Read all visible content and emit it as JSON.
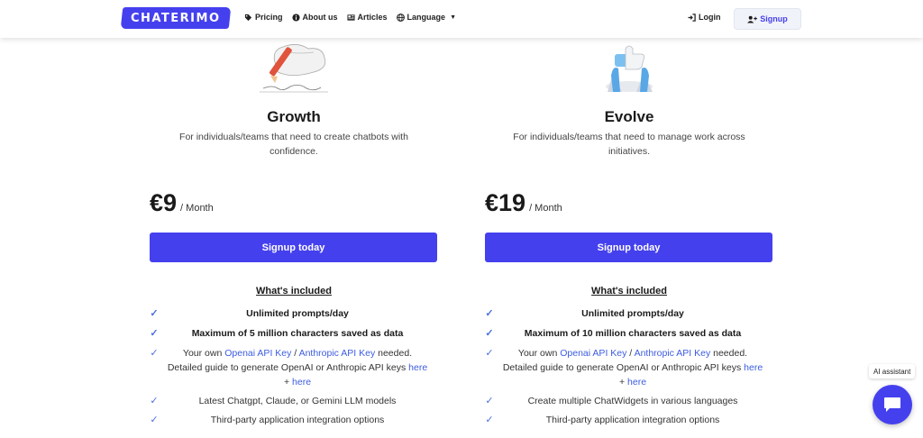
{
  "nav": {
    "logo": "CHATERIMO",
    "links": [
      {
        "label": "Pricing",
        "icon": "tag-icon"
      },
      {
        "label": "About us",
        "icon": "info-icon"
      },
      {
        "label": "Articles",
        "icon": "newspaper-icon"
      },
      {
        "label": "Language",
        "icon": "globe-icon"
      }
    ],
    "login": "Login",
    "signup": "Signup"
  },
  "plans": [
    {
      "name": "Growth",
      "description": "For individuals/teams that need to create chatbots with confidence.",
      "price": "€9",
      "period": "/ Month",
      "cta": "Signup today",
      "included_heading": "What's included",
      "features": {
        "f1": "Unlimited prompts/day",
        "f2": "Maximum of 5 million characters saved as data",
        "f3_pre": "Your own ",
        "f3_link1": "Openai API Key",
        "f3_sep": " / ",
        "f3_link2": "Anthropic API Key",
        "f3_mid": " needed. Detailed guide to generate OpenAI or Anthropic API keys ",
        "f3_link3": "here",
        "f3_plus": " + ",
        "f3_link4": "here",
        "f4": "Latest Chatgpt, Claude, or Gemini LLM models",
        "f5": "Third-party application integration options"
      }
    },
    {
      "name": "Evolve",
      "description": "For individuals/teams that need to manage work across initiatives.",
      "price": "€19",
      "period": "/ Month",
      "cta": "Signup today",
      "included_heading": "What's included",
      "features": {
        "f1": "Unlimited prompts/day",
        "f2": "Maximum of 10 million characters saved as data",
        "f3_pre": "Your own ",
        "f3_link1": "Openai API Key",
        "f3_sep": " / ",
        "f3_link2": "Anthropic API Key",
        "f3_mid": " needed. Detailed guide to generate OpenAI or Anthropic API keys ",
        "f3_link3": "here",
        "f3_plus": " + ",
        "f3_link4": "here",
        "f4": "Create multiple ChatWidgets in various languages",
        "f5": "Third-party application integration options"
      }
    }
  ],
  "assistant": {
    "label": "AI assistant",
    "icon": "chat-bubble-icon"
  },
  "colors": {
    "accent": "#4540ee",
    "link": "#3c5ce0",
    "check": "#4a6fe0"
  }
}
